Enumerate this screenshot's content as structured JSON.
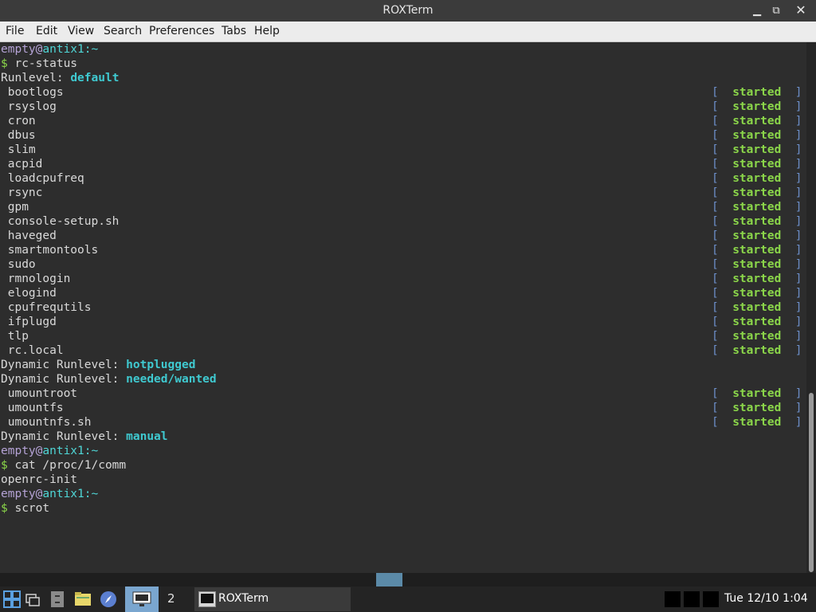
{
  "window": {
    "title": "ROXTerm",
    "min": "▁",
    "max": "⧉",
    "close": "✕"
  },
  "menu": [
    "File",
    "Edit",
    "View",
    "Search",
    "Preferences",
    "Tabs",
    "Help"
  ],
  "prompt": {
    "user": "empty",
    "at": "@",
    "host": "antix1",
    "path": ":~",
    "dollar": "$"
  },
  "commands": {
    "rc": "rc-status",
    "cat": "cat /proc/1/comm",
    "scrot": "scrot"
  },
  "output": {
    "cat_result": "openrc-init"
  },
  "runlevels": {
    "label": "Runlevel: ",
    "dyn_label": "Dynamic Runlevel: ",
    "default": "default",
    "hotplugged": "hotplugged",
    "needed": "needed/wanted",
    "manual": "manual"
  },
  "services_default": [
    "bootlogs",
    "rsyslog",
    "cron",
    "dbus",
    "slim",
    "acpid",
    "loadcpufreq",
    "rsync",
    "gpm",
    "console-setup.sh",
    "haveged",
    "smartmontools",
    "sudo",
    "rmnologin",
    "elogind",
    "cpufrequtils",
    "ifplugd",
    "tlp",
    "rc.local"
  ],
  "services_needed": [
    "umountroot",
    "umountfs",
    "umountnfs.sh"
  ],
  "status_word": "started",
  "status_open": "[",
  "status_close": "]",
  "taskbar": {
    "desktop_num": "2",
    "task_label": "ROXTerm",
    "clock": "Tue 12/10  1:04"
  },
  "colors": {
    "user": "#b5a3d6",
    "host": "#4fd6d6",
    "runlevel": "#3fc9d0",
    "started": "#8bd64a",
    "bracket": "#6c8ec9"
  }
}
